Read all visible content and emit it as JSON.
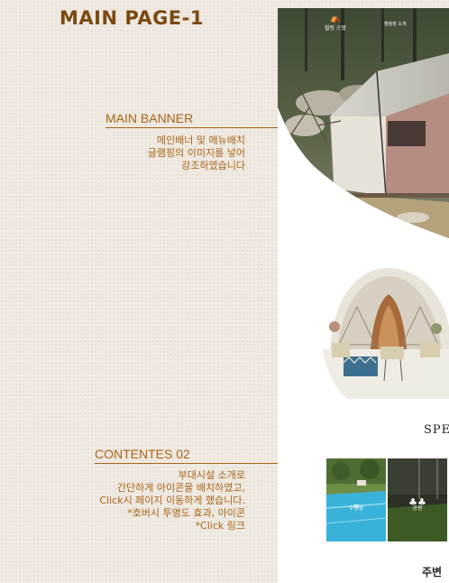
{
  "page": {
    "title": "MAIN PAGE-1"
  },
  "sections": {
    "main_banner": {
      "heading": "MAIN BANNER",
      "lines": [
        "메인배너 및 메뉴배치",
        "글램핑의 이미지를 넣어",
        "강조하였습니다"
      ]
    },
    "contents_02": {
      "heading": "CONTENTES 02",
      "lines": [
        "부대시설 소개로",
        "간단하게 아이콘을 배치하였고,",
        "Click시 페이지 이동하게 했습니다.",
        "*호버시 투명도 효과, 아이콘",
        "*Click 링크"
      ]
    }
  },
  "preview": {
    "logo_text": "힐링 스팟",
    "nav_item": "캠핑장 소개",
    "special_heading": "SPE",
    "thumbs": [
      "수영장",
      "공원"
    ],
    "nearby_heading": "주변"
  },
  "colors": {
    "title": "#7b4a12",
    "accent": "#a8661a",
    "paper": "#efe9e1"
  }
}
